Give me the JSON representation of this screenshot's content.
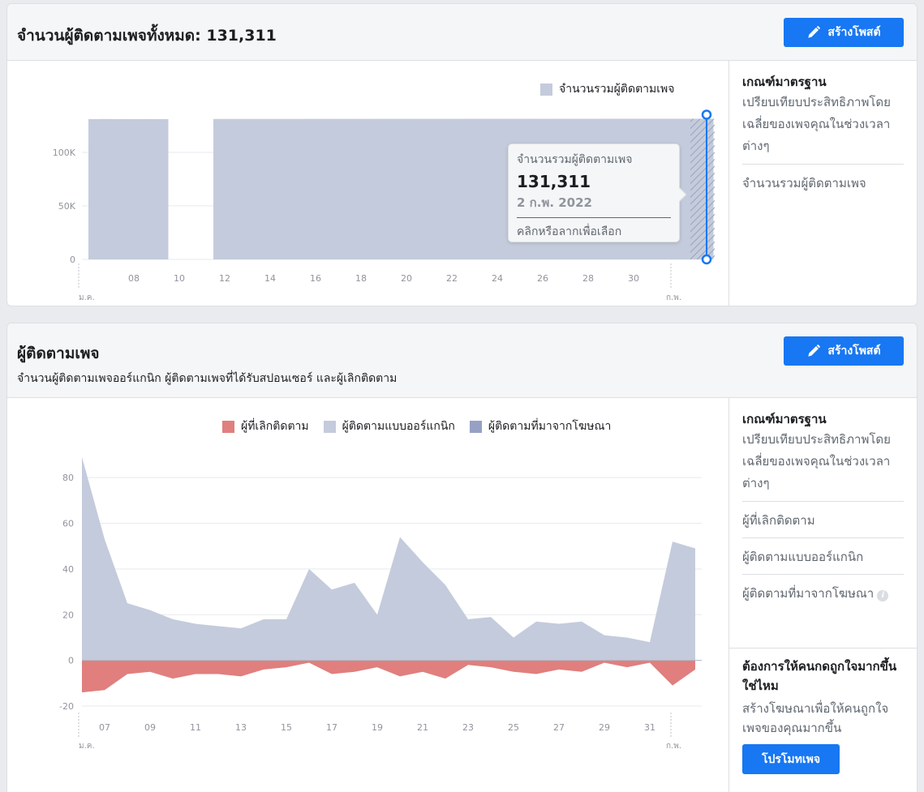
{
  "section1": {
    "title": "จำนวนผู้ติดตามเพจทั้งหมด: 131,311",
    "create_post_label": "สร้างโพสต์",
    "legend": "จำนวนรวมผู้ติดตามเพจ",
    "tooltip": {
      "label": "จำนวนรวมผู้ติดตามเพจ",
      "value": "131,311",
      "date": "2 ก.พ. 2022",
      "hint": "คลิกหรือลากเพื่อเลือก"
    },
    "sidebar": {
      "heading": "เกณฑ์มาตรฐาน",
      "text": "เปรียบเทียบประสิทธิภาพโดยเฉลี่ยของเพจคุณในช่วงเวลาต่างๆ",
      "links": [
        "จำนวนรวมผู้ติดตามเพจ"
      ]
    }
  },
  "section2": {
    "title": "ผู้ติดตามเพจ",
    "subtitle": "จำนวนผู้ติดตามเพจออร์แกนิก ผู้ติดตามเพจที่ได้รับสปอนเซอร์ และผู้เลิกติดตาม",
    "create_post_label": "สร้างโพสต์",
    "legend": [
      "ผู้ที่เลิกติดตาม",
      "ผู้ติดตามแบบออร์แกนิก",
      "ผู้ติดตามที่มาจากโฆษณา"
    ],
    "sidebar": {
      "heading": "เกณฑ์มาตรฐาน",
      "text": "เปรียบเทียบประสิทธิภาพโดยเฉลี่ยของเพจคุณในช่วงเวลาต่างๆ",
      "links": [
        "ผู้ที่เลิกติดตาม",
        "ผู้ติดตามแบบออร์แกนิก",
        "ผู้ติดตามที่มาจากโฆษณา"
      ]
    },
    "promo": {
      "heading": "ต้องการให้คนกดถูกใจมากขึ้นใช่ไหม",
      "text": "สร้างโฆษณาเพื่อให้คนถูกใจเพจของคุณมากขึ้น",
      "button": "โปรโมทเพจ"
    }
  },
  "colors": {
    "accent": "#1877f2",
    "total_fill": "#c4cbdc",
    "organic": "#c4cbdc",
    "paid": "#97a1c5",
    "unfollow": "#e07f7d"
  },
  "chart_data": [
    {
      "type": "area",
      "x": [
        "06",
        "07",
        "08",
        "09",
        "10",
        "11",
        "12",
        "13",
        "14",
        "15",
        "16",
        "17",
        "18",
        "19",
        "20",
        "21",
        "22",
        "23",
        "24",
        "25",
        "26",
        "27",
        "28",
        "29",
        "30",
        "31",
        "01",
        "02"
      ],
      "tick_labels": [
        "08",
        "10",
        "12",
        "14",
        "16",
        "18",
        "20",
        "22",
        "24",
        "26",
        "28",
        "30"
      ],
      "month_labels": [
        "ม.ค.",
        "ก.พ."
      ],
      "yticks": [
        "0",
        "50K",
        "100K"
      ],
      "ylim": [
        0,
        140000
      ],
      "series": [
        {
          "name": "จำนวนรวมผู้ติดตามเพจ",
          "values": [
            131000,
            131000,
            131000,
            131000,
            null,
            null,
            131100,
            131100,
            131100,
            131100,
            131150,
            131150,
            131150,
            131200,
            131200,
            131200,
            131200,
            131250,
            131250,
            131250,
            131260,
            131270,
            131280,
            131290,
            131300,
            131300,
            131305,
            131311
          ]
        }
      ],
      "gaps": [
        "09",
        "10",
        "11"
      ]
    },
    {
      "type": "area",
      "x": [
        "06",
        "07",
        "08",
        "09",
        "10",
        "11",
        "12",
        "13",
        "14",
        "15",
        "16",
        "17",
        "18",
        "19",
        "20",
        "21",
        "22",
        "23",
        "24",
        "25",
        "26",
        "27",
        "28",
        "29",
        "30",
        "31",
        "01",
        "02"
      ],
      "tick_labels": [
        "07",
        "09",
        "11",
        "13",
        "15",
        "17",
        "19",
        "21",
        "23",
        "25",
        "27",
        "29",
        "31"
      ],
      "month_labels": [
        "ม.ค.",
        "ก.พ."
      ],
      "yticks": [
        "-20",
        "0",
        "20",
        "40",
        "60",
        "80"
      ],
      "ylim": [
        -20,
        90
      ],
      "series": [
        {
          "name": "ผู้ติดตามแบบออร์แกนิก",
          "values": [
            89,
            53,
            25,
            22,
            18,
            16,
            15,
            14,
            18,
            18,
            40,
            31,
            34,
            20,
            54,
            43,
            33,
            18,
            19,
            10,
            17,
            16,
            17,
            11,
            10,
            8,
            52,
            49
          ]
        },
        {
          "name": "ผู้ที่เลิกติดตาม",
          "values": [
            -14,
            -13,
            -6,
            -5,
            -8,
            -6,
            -6,
            -7,
            -4,
            -3,
            -1,
            -6,
            -5,
            -3,
            -7,
            -5,
            -8,
            -2,
            -3,
            -5,
            -6,
            -4,
            -5,
            -1,
            -3,
            -1,
            -11,
            -4
          ]
        }
      ]
    }
  ]
}
